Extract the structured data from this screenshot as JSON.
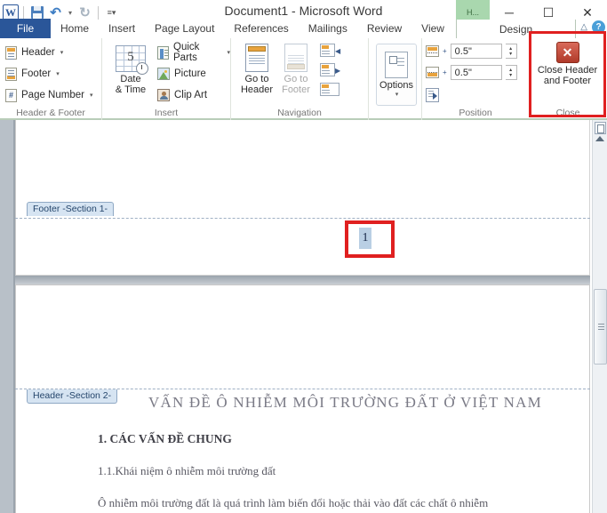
{
  "window": {
    "title": "Document1  -  Microsoft Word",
    "minimize_label": "─",
    "maximize_label": "☐",
    "close_label": "✕",
    "contextual_tab_chip": "H..."
  },
  "quick_access": {
    "app_logo": "W",
    "save_label": "Save",
    "undo_label": "↶",
    "undo_caret": "▾",
    "redo_label": "↻",
    "customize_label": "≡▾"
  },
  "tabs": {
    "file": "File",
    "items": [
      "Home",
      "Insert",
      "Page Layout",
      "References",
      "Mailings",
      "Review",
      "View"
    ],
    "contextual": "Design",
    "minimize_ribbon": "△",
    "help": "?"
  },
  "ribbon": {
    "groups": [
      {
        "name": "Header & Footer",
        "label": "Header & Footer",
        "items": [
          {
            "label": "Header",
            "caret": "▾"
          },
          {
            "label": "Footer",
            "caret": "▾"
          },
          {
            "label": "Page Number",
            "caret": "▾"
          }
        ]
      },
      {
        "name": "Insert",
        "label": "Insert",
        "big": {
          "line1": "Date",
          "line2": "& Time",
          "glyph": "5"
        },
        "items": [
          {
            "label": "Quick Parts",
            "caret": "▾"
          },
          {
            "label": "Picture",
            "caret": ""
          },
          {
            "label": "Clip Art",
            "caret": ""
          }
        ]
      },
      {
        "name": "Navigation",
        "label": "Navigation",
        "goto_header": {
          "line1": "Go to",
          "line2": "Header"
        },
        "goto_footer": {
          "line1": "Go to",
          "line2": "Footer"
        },
        "link_previous_arrow": "◀",
        "link_next_arrow": "▶"
      },
      {
        "name": "Options",
        "label": "",
        "button_label": "Options",
        "caret": "▾"
      },
      {
        "name": "Position",
        "label": "Position",
        "header_from_top": "0.5\"",
        "footer_from_bottom": "0.5\"",
        "spin_up": "▴",
        "spin_down": "▾",
        "plus": "+"
      },
      {
        "name": "Close",
        "label": "Close",
        "button_line1": "Close Header",
        "button_line2": "and Footer",
        "button_glyph": "✕"
      }
    ]
  },
  "document": {
    "footer_section_tab": "Footer -Section 1-",
    "header_section_tab": "Header -Section 2-",
    "page_number_value": "1",
    "header_title": "VẤN ĐỀ Ô NHIỄM  MÔI TRƯỜNG ĐẤT Ở VIỆT  NAM",
    "heading_1": "1. CÁC VẤN ĐỀ CHUNG",
    "subheading_1": "1.1.Khái niệm ô nhiễm môi trường đất",
    "paragraph_1": "Ô nhiễm môi trường đất là quá trình làm biến đổi hoặc thải vào đất các chất ô nhiễm"
  },
  "colors": {
    "accent_blue": "#2a5699",
    "highlight_red": "#e02020",
    "contextual_green": "#a9d7ae",
    "selection_blue": "#b9cfe4"
  }
}
